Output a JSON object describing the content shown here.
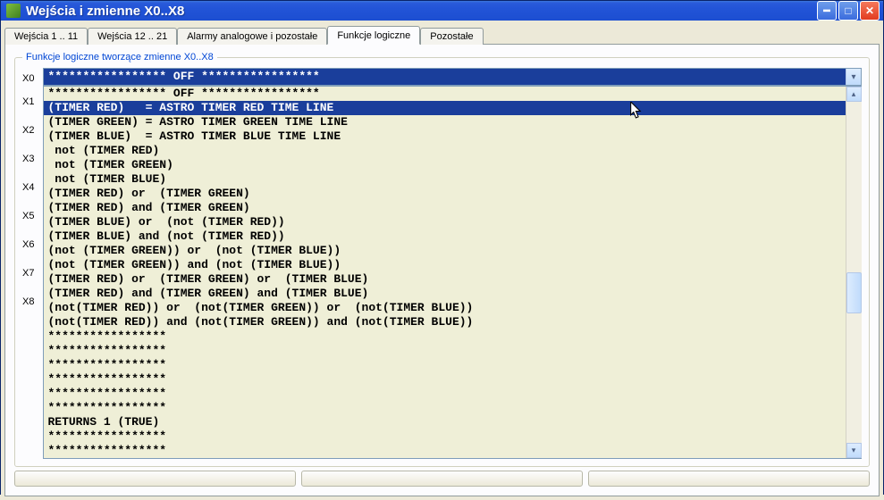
{
  "window": {
    "title": "Wejścia i zmienne X0..X8"
  },
  "tabs": [
    {
      "label": "Wejścia 1 .. 11",
      "active": false
    },
    {
      "label": "Wejścia 12 .. 21",
      "active": false
    },
    {
      "label": "Alarmy analogowe i pozostałe",
      "active": false
    },
    {
      "label": "Funkcje logiczne",
      "active": true
    },
    {
      "label": "Pozostałe",
      "active": false
    }
  ],
  "groupbox": {
    "legend": "Funkcje logiczne tworzące zmienne X0..X8"
  },
  "row_labels": [
    "X0",
    "X1",
    "X2",
    "X3",
    "X4",
    "X5",
    "X6",
    "X7",
    "X8"
  ],
  "combo": {
    "selected": "***************** OFF *****************"
  },
  "options": [
    "***************** OFF *****************",
    "(TIMER RED)   = ASTRO TIMER RED TIME LINE",
    "(TIMER GREEN) = ASTRO TIMER GREEN TIME LINE",
    "(TIMER BLUE)  = ASTRO TIMER BLUE TIME LINE",
    " not (TIMER RED)",
    " not (TIMER GREEN)",
    " not (TIMER BLUE)",
    "(TIMER RED) or  (TIMER GREEN)",
    "(TIMER RED) and (TIMER GREEN)",
    "(TIMER BLUE) or  (not (TIMER RED))",
    "(TIMER BLUE) and (not (TIMER RED))",
    "(not (TIMER GREEN)) or  (not (TIMER BLUE))",
    "(not (TIMER GREEN)) and (not (TIMER BLUE))",
    "(TIMER RED) or  (TIMER GREEN) or  (TIMER BLUE)",
    "(TIMER RED) and (TIMER GREEN) and (TIMER BLUE)",
    "(not(TIMER RED)) or  (not(TIMER GREEN)) or  (not(TIMER BLUE))",
    "(not(TIMER RED)) and (not(TIMER GREEN)) and (not(TIMER BLUE))",
    "*****************",
    "*****************",
    "*****************",
    "*****************",
    "*****************",
    "*****************",
    "RETURNS 1 (TRUE)",
    "*****************",
    "*****************"
  ],
  "highlight_index": 1
}
